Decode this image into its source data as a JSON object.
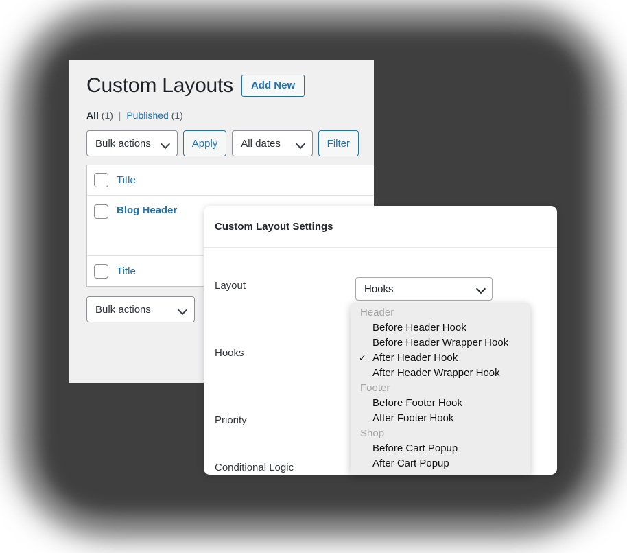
{
  "colors": {
    "accent_blue": "#2271b1",
    "panel_bg": "#f0f0f1",
    "text_dark": "#1d2327",
    "muted": "#8c8f94",
    "popup_bg": "#ededed",
    "group_label": "#a5a5a5"
  },
  "wp_panel": {
    "page_title": "Custom Layouts",
    "add_new_label": "Add New",
    "views": {
      "all_label": "All",
      "all_count": "(1)",
      "separator": "|",
      "published_label": "Published",
      "published_count": "(1)"
    },
    "tablenav_top": {
      "bulk_actions_value": "Bulk actions",
      "apply_label": "Apply",
      "dates_value": "All dates",
      "filter_label": "Filter"
    },
    "table": {
      "header": {
        "title_column": "Title"
      },
      "rows": [
        {
          "title": "Blog Header",
          "bold": true
        }
      ],
      "footer": {
        "title_column": "Title"
      }
    },
    "tablenav_bottom": {
      "bulk_actions_value": "Bulk actions"
    }
  },
  "modal": {
    "title": "Custom Layout Settings",
    "fields": {
      "layout_label": "Layout",
      "layout_value": "Hooks",
      "hooks_label": "Hooks",
      "priority_label": "Priority",
      "conditional_logic_label": "Conditional Logic"
    },
    "dropdown": {
      "selected": "After Header Hook",
      "checkmark": "✓",
      "groups": [
        {
          "label": "Header",
          "options": [
            "Before Header Hook",
            "Before Header Wrapper Hook",
            "After Header Hook",
            "After Header Wrapper Hook"
          ]
        },
        {
          "label": "Footer",
          "options": [
            "Before Footer Hook",
            "After Footer Hook"
          ]
        },
        {
          "label": "Shop",
          "options": [
            "Before Cart Popup",
            "After Cart Popup"
          ]
        }
      ]
    }
  }
}
